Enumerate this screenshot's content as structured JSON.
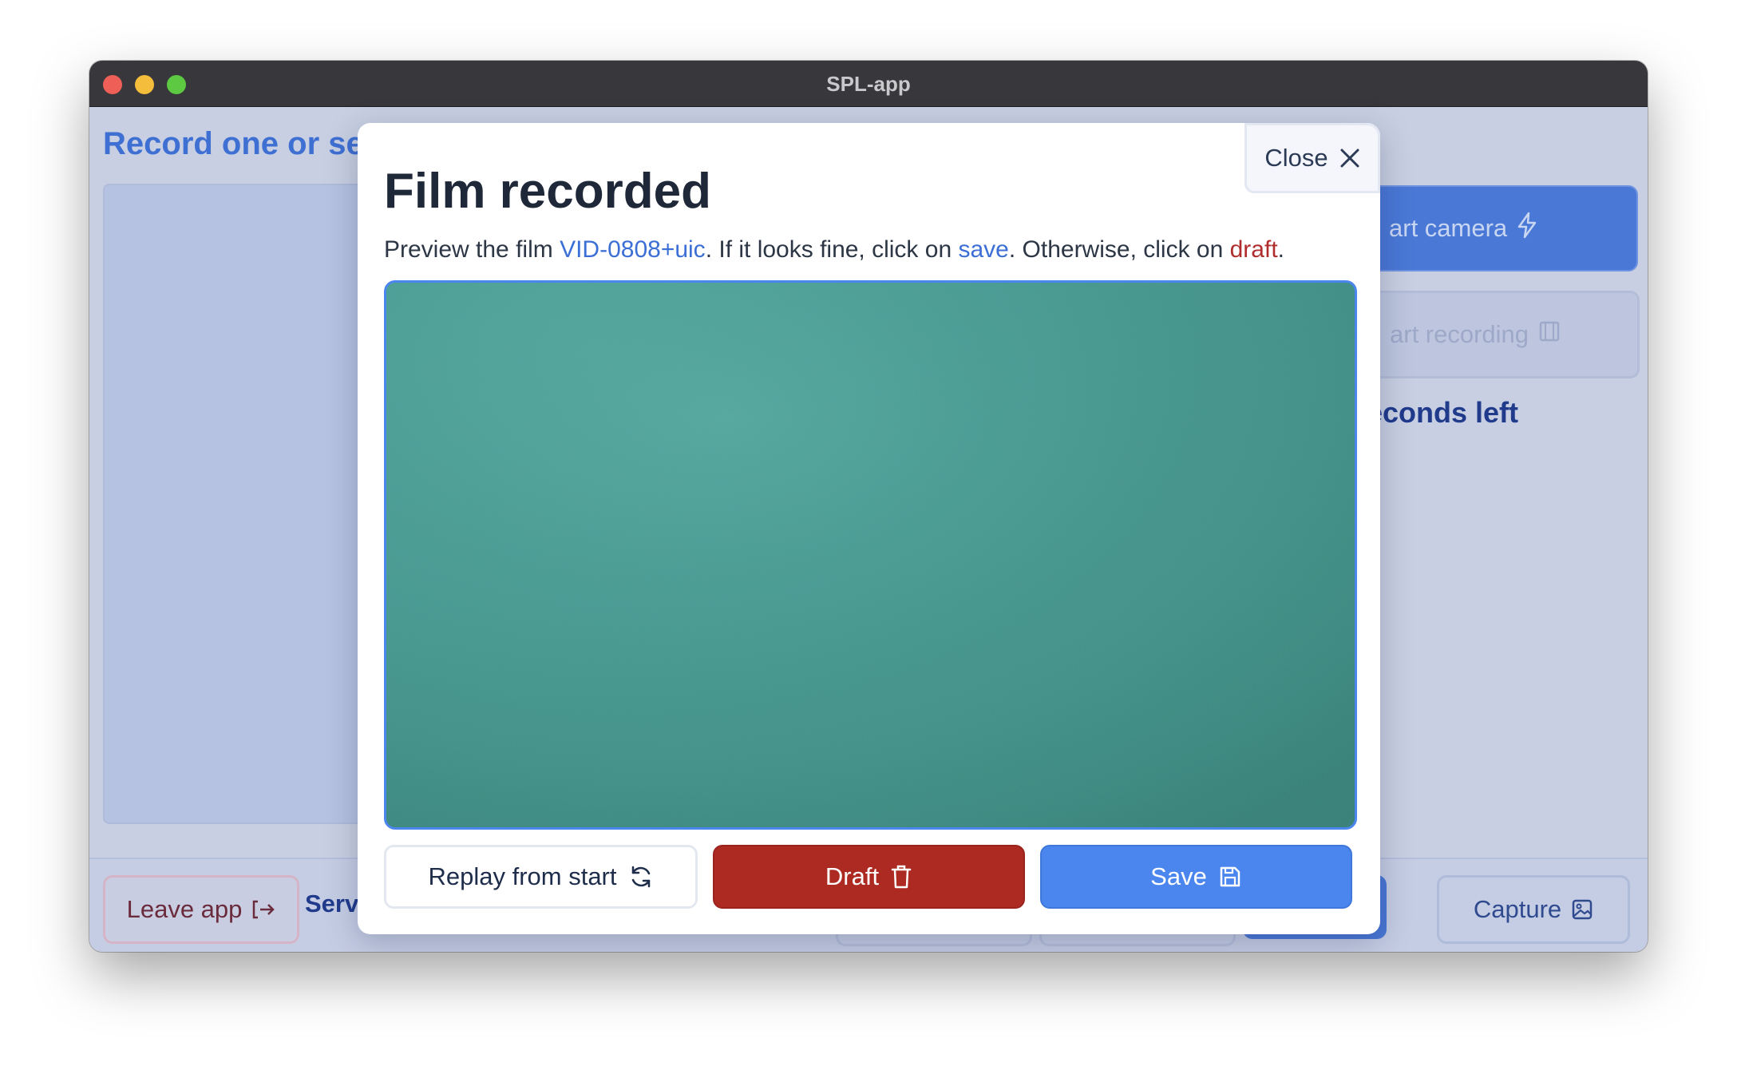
{
  "window": {
    "title": "SPL-app"
  },
  "background": {
    "heading": "Record one or sev",
    "start_camera_label": "art camera",
    "start_recording_label": "art recording",
    "seconds_left": "econds left",
    "leave_label": "Leave app",
    "service_label": "Servi",
    "capture_label": "Capture"
  },
  "modal": {
    "close_label": "Close",
    "title": "Film recorded",
    "desc": {
      "part1": "Preview the film ",
      "film_id": "VID-0808+uic",
      "part2": ". If it looks fine, click on ",
      "save_word": "save",
      "part3": ". Otherwise, click on ",
      "draft_word": "draft",
      "part4": "."
    },
    "buttons": {
      "replay": "Replay from start",
      "draft": "Draft",
      "save": "Save"
    }
  },
  "colors": {
    "accent": "#4a86ee",
    "danger": "#ad2a22",
    "video": "#469a91"
  },
  "icons": {
    "close": "close-icon",
    "replay": "refresh-icon",
    "draft": "trash-icon",
    "save": "save-icon",
    "camera": "lightning-icon",
    "recording": "film-icon",
    "leave": "exit-icon",
    "capture": "image-icon"
  }
}
